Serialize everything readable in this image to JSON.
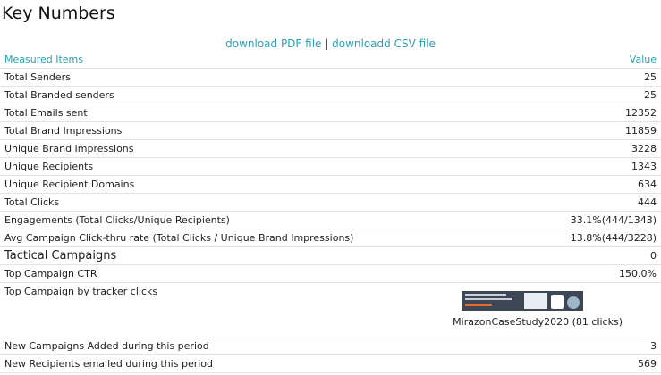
{
  "title": "Key Numbers",
  "downloads": {
    "pdf": "download PDF file",
    "sep": "|",
    "csv": "downloadd CSV file"
  },
  "table": {
    "header": {
      "item": "Measured Items",
      "value": "Value"
    },
    "rows": [
      {
        "label": "Total Senders",
        "value": "25"
      },
      {
        "label": "Total Branded senders",
        "value": "25"
      },
      {
        "label": "Total Emails sent",
        "value": "12352"
      },
      {
        "label": "Total Brand Impressions",
        "value": "11859"
      },
      {
        "label": "Unique Brand Impressions",
        "value": "3228"
      },
      {
        "label": "Unique Recipients",
        "value": "1343"
      },
      {
        "label": "Unique Recipient Domains",
        "value": "634"
      },
      {
        "label": "Total Clicks",
        "value": "444"
      },
      {
        "label": "Engagements (Total Clicks/Unique Recipients)",
        "value": "33.1%(444/1343)"
      },
      {
        "label": "Avg Campaign Click-thru rate (Total Clicks / Unique Brand Impressions)",
        "value": "13.8%(444/3228)"
      },
      {
        "label": "Tactical Campaigns",
        "value": "0"
      },
      {
        "label": "Top Campaign CTR",
        "value": "150.0%"
      },
      {
        "label": "Top Campaign by tracker clicks",
        "value": "MirazonCaseStudy2020 (81 clicks)"
      },
      {
        "label": "New Campaigns Added during this period",
        "value": "3"
      },
      {
        "label": "New Recipients emailed during this period",
        "value": "569"
      }
    ]
  }
}
